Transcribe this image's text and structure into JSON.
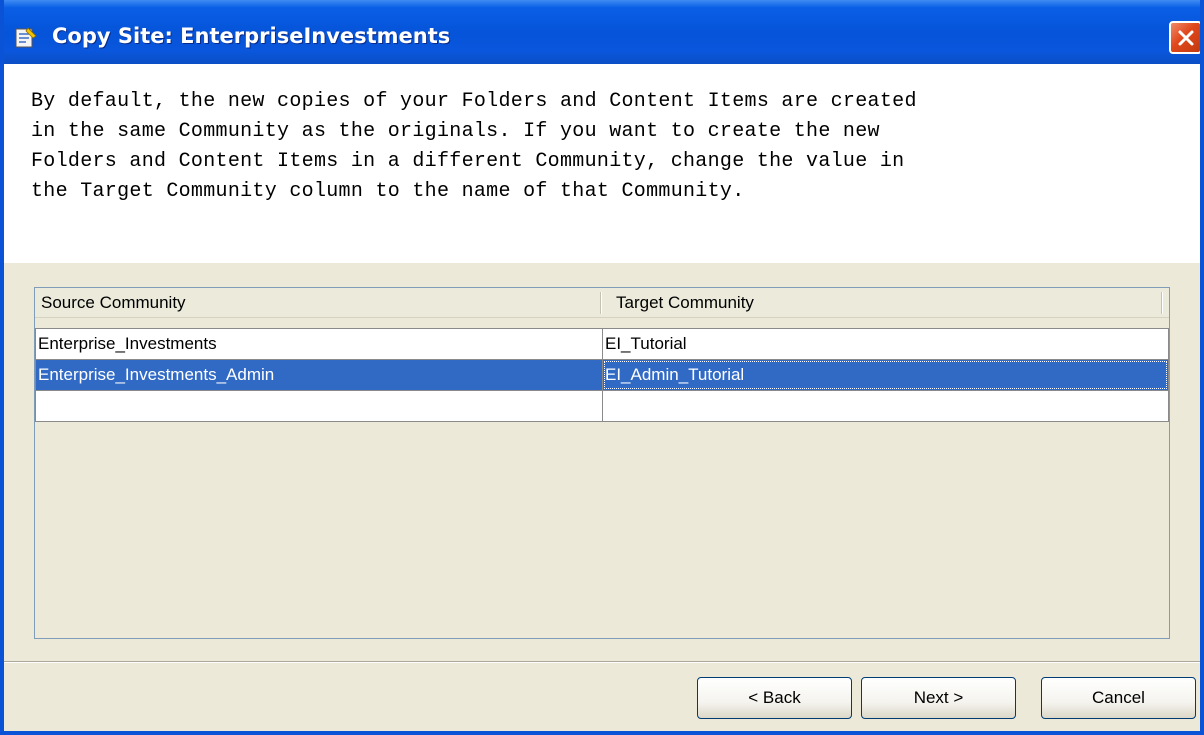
{
  "window": {
    "title": "Copy Site: EnterpriseInvestments"
  },
  "intro": {
    "text": "By default, the new copies of your Folders and Content Items are created\nin the same Community as the originals. If you want to create the new\nFolders and Content Items in a different Community, change the value in\nthe Target Community column to the name of that Community."
  },
  "grid": {
    "columns": [
      "Source Community",
      "Target Community"
    ],
    "rows": [
      {
        "source": "Enterprise_Investments",
        "target": "EI_Tutorial",
        "selected": false
      },
      {
        "source": "Enterprise_Investments_Admin",
        "target": "EI_Admin_Tutorial",
        "selected": true
      },
      {
        "source": "",
        "target": "",
        "selected": false
      }
    ]
  },
  "buttons": {
    "back": "< Back",
    "next": "Next >",
    "cancel": "Cancel"
  },
  "icons": {
    "title": "wizard-app-icon",
    "close": "close-icon"
  },
  "colors": {
    "titlebar": "#0554d9",
    "selection": "#316ac5",
    "close": "#e0471c",
    "dialog_bg": "#ece9d8"
  }
}
